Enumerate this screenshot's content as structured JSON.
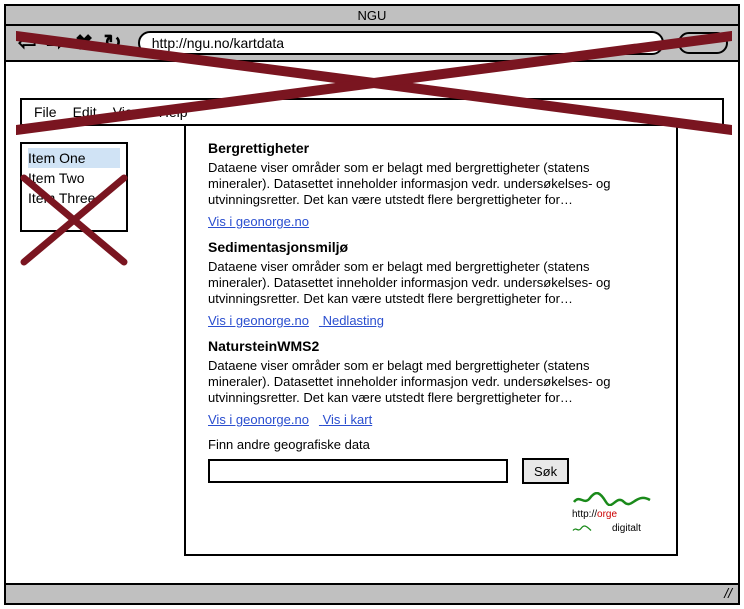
{
  "window": {
    "title": "NGU"
  },
  "browser": {
    "url": "http://ngu.no/kartdata"
  },
  "menu": {
    "items": [
      "File",
      "Edit",
      "View",
      "Help"
    ]
  },
  "sidebar": {
    "items": [
      {
        "label": "Item One"
      },
      {
        "label": "Item Two"
      },
      {
        "label": "Item Three"
      }
    ]
  },
  "panel": {
    "entries": [
      {
        "title": "Bergrettigheter",
        "description": "Dataene viser områder som er belagt med bergrettigheter (statens mineraler). Datasettet inneholder informasjon vedr. undersøkelses- og utvinningsretter. Det kan være utstedt flere bergrettigheter for…",
        "links": [
          {
            "label": "Vis i geonorge.no"
          }
        ]
      },
      {
        "title": "Sedimentasjonsmiljø",
        "description": "Dataene viser områder som er belagt med bergrettigheter (statens mineraler). Datasettet inneholder informasjon vedr. undersøkelses- og utvinningsretter. Det kan være utstedt flere bergrettigheter for…",
        "links": [
          {
            "label": "Vis i geonorge.no"
          },
          {
            "label": "Nedlasting"
          }
        ]
      },
      {
        "title": "NatursteinWMS2",
        "description": "Dataene viser områder som er belagt med bergrettigheter (statens mineraler). Datasettet inneholder informasjon vedr. undersøkelses- og utvinningsretter. Det kan være utstedt flere bergrettigheter for…",
        "links": [
          {
            "label": "Vis i geonorge.no"
          },
          {
            "label": "Vis i kart"
          }
        ]
      }
    ],
    "search": {
      "label": "Finn andre geografiske data",
      "button": "Søk",
      "value": ""
    },
    "logo": {
      "line1a": "http://",
      "line1b": "orge",
      "line2": "digitalt"
    }
  }
}
